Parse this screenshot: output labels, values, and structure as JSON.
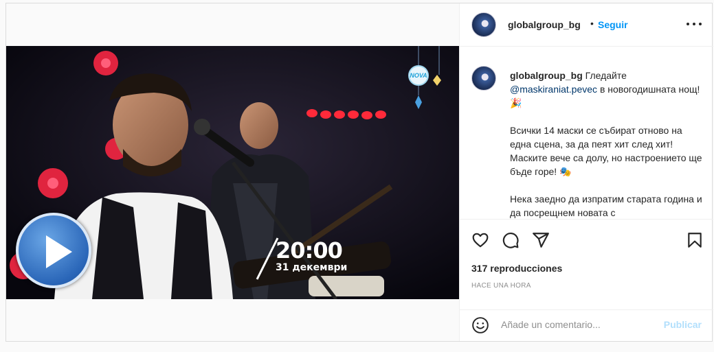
{
  "post": {
    "username": "globalgroup_bg",
    "follow_label": "Seguir",
    "separator": "•",
    "caption_mention": "@maskiraniat.pevec",
    "caption_lead": "Гледайте",
    "caption_tail": "в новогодишната нощ! 🎉",
    "caption_p2": "Всички 14 маски се събират отново на една сцена, за да пеят хит след хит! Маските вече са долу, но настроението ще бъде горе! 🎭",
    "caption_p3": "Нека заедно да изпратим старата година и да посрещнем новата с",
    "views": "317 reproducciones",
    "time_ago": "HACE UNA HORA",
    "comment_placeholder": "Añade un comentario...",
    "publish_label": "Publicar"
  },
  "video": {
    "time_text": "20:00",
    "date_text": "31 декември",
    "channel_logo_text": "NOVA"
  },
  "icons": {
    "like": "heart-icon",
    "comment": "comment-icon",
    "share": "share-icon",
    "save": "bookmark-icon",
    "more": "more-options-icon",
    "emoji": "emoji-icon",
    "play": "play-icon"
  },
  "colors": {
    "link": "#0095f6",
    "mention": "#00376b",
    "publish_disabled": "#b2dffc",
    "muted": "#8e8e8e"
  }
}
